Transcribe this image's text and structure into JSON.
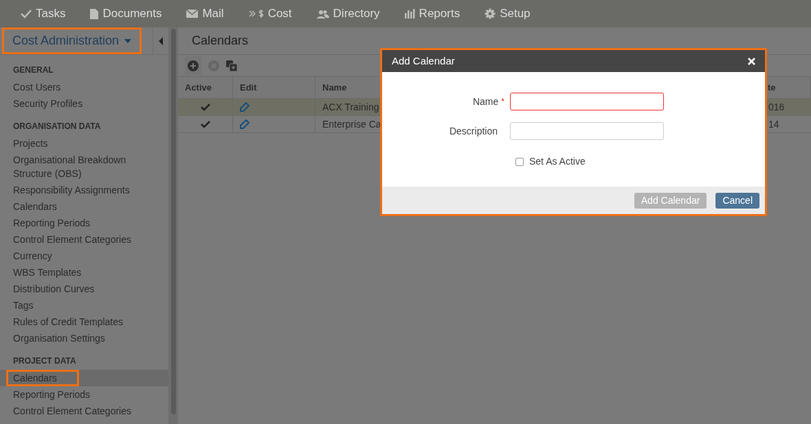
{
  "nav": [
    {
      "label": "Tasks"
    },
    {
      "label": "Documents"
    },
    {
      "label": "Mail"
    },
    {
      "label": "Cost"
    },
    {
      "label": "Directory"
    },
    {
      "label": "Reports"
    },
    {
      "label": "Setup"
    }
  ],
  "sidebar": {
    "module": {
      "label": "Cost Administration",
      "highlighted": true
    },
    "sections": [
      {
        "heading": "GENERAL",
        "items": [
          {
            "label": "Cost Users",
            "selected": false,
            "highlighted": false
          },
          {
            "label": "Security Profiles",
            "selected": false,
            "highlighted": false
          }
        ]
      },
      {
        "heading": "ORGANISATION DATA",
        "items": [
          {
            "label": "Projects",
            "selected": false,
            "highlighted": false
          },
          {
            "label": "Organisational Breakdown Structure (OBS)",
            "selected": false,
            "highlighted": false
          },
          {
            "label": "Responsibility Assignments",
            "selected": false,
            "highlighted": false
          },
          {
            "label": "Calendars",
            "selected": false,
            "highlighted": false
          },
          {
            "label": "Reporting Periods",
            "selected": false,
            "highlighted": false
          },
          {
            "label": "Control Element Categories",
            "selected": false,
            "highlighted": false
          },
          {
            "label": "Currency",
            "selected": false,
            "highlighted": false
          },
          {
            "label": "WBS Templates",
            "selected": false,
            "highlighted": false
          },
          {
            "label": "Distribution Curves",
            "selected": false,
            "highlighted": false
          },
          {
            "label": "Tags",
            "selected": false,
            "highlighted": false
          },
          {
            "label": "Rules of Credit Templates",
            "selected": false,
            "highlighted": false
          },
          {
            "label": "Organisation Settings",
            "selected": false,
            "highlighted": false
          }
        ]
      },
      {
        "heading": "PROJECT DATA",
        "items": [
          {
            "label": "Calendars",
            "selected": true,
            "highlighted": true
          },
          {
            "label": "Reporting Periods",
            "selected": false,
            "highlighted": false
          },
          {
            "label": "Control Element Categories",
            "selected": false,
            "highlighted": false
          }
        ]
      }
    ]
  },
  "page": {
    "title": "Calendars"
  },
  "table": {
    "columns": [
      "Active",
      "Edit",
      "Name",
      "te"
    ],
    "rows": [
      {
        "active": true,
        "name": "ACX Training",
        "column_4": "016",
        "selected": true
      },
      {
        "active": true,
        "name": "Enterprise Ca",
        "column_4": "14",
        "selected": false
      }
    ]
  },
  "dialog": {
    "title": "Add Calendar",
    "highlighted": true,
    "required_mark": "*",
    "fields": [
      {
        "label": "Name",
        "required": true,
        "invalid": true
      },
      {
        "label": "Description",
        "required": false,
        "invalid": false
      }
    ],
    "checkbox": {
      "label": "Set As Active",
      "checked": false
    },
    "buttons": [
      {
        "label": "Add Calendar",
        "kind": "primary",
        "disabled": true
      },
      {
        "label": "Cancel",
        "kind": "secondary",
        "disabled": false
      }
    ]
  }
}
